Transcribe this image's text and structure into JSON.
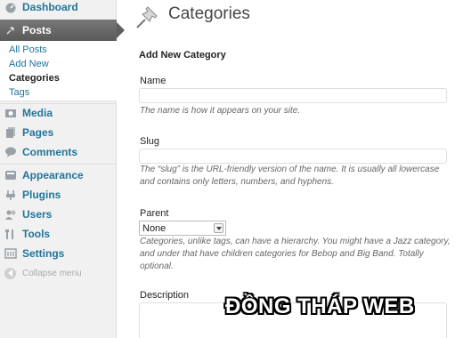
{
  "sidebar": {
    "dashboard": {
      "label": "Dashboard",
      "icon": "dashboard-icon"
    },
    "posts": {
      "label": "Posts",
      "icon": "pin-icon"
    },
    "posts_submenu": [
      "All Posts",
      "Add New",
      "Categories",
      "Tags"
    ],
    "media": {
      "label": "Media",
      "icon": "media-icon"
    },
    "pages": {
      "label": "Pages",
      "icon": "pages-icon"
    },
    "comments": {
      "label": "Comments",
      "icon": "comments-icon"
    },
    "appearance": {
      "label": "Appearance",
      "icon": "appearance-icon"
    },
    "plugins": {
      "label": "Plugins",
      "icon": "plugins-icon"
    },
    "users": {
      "label": "Users",
      "icon": "users-icon"
    },
    "tools": {
      "label": "Tools",
      "icon": "tools-icon"
    },
    "settings": {
      "label": "Settings",
      "icon": "settings-icon"
    },
    "collapse": "Collapse menu"
  },
  "main": {
    "title": "Categories",
    "section_title": "Add New Category",
    "name_label": "Name",
    "name_value": "",
    "name_help": "The name is how it appears on your site.",
    "slug_label": "Slug",
    "slug_value": "",
    "slug_help": "The “slug” is the URL-friendly version of the name. It is usually all lowercase and contains only letters, numbers, and hyphens.",
    "parent_label": "Parent",
    "parent_selected": "None",
    "parent_help": "Categories, unlike tags, can have a hierarchy. You might have a Jazz category, and under that have children categories for Bebop and Big Band. Totally optional.",
    "description_label": "Description"
  },
  "watermark": "ĐỒNG THÁP WEB",
  "colors": {
    "link": "#21759b",
    "active_menu": "#5e5e5e",
    "sidebar_bg": "#f1f1f1"
  }
}
